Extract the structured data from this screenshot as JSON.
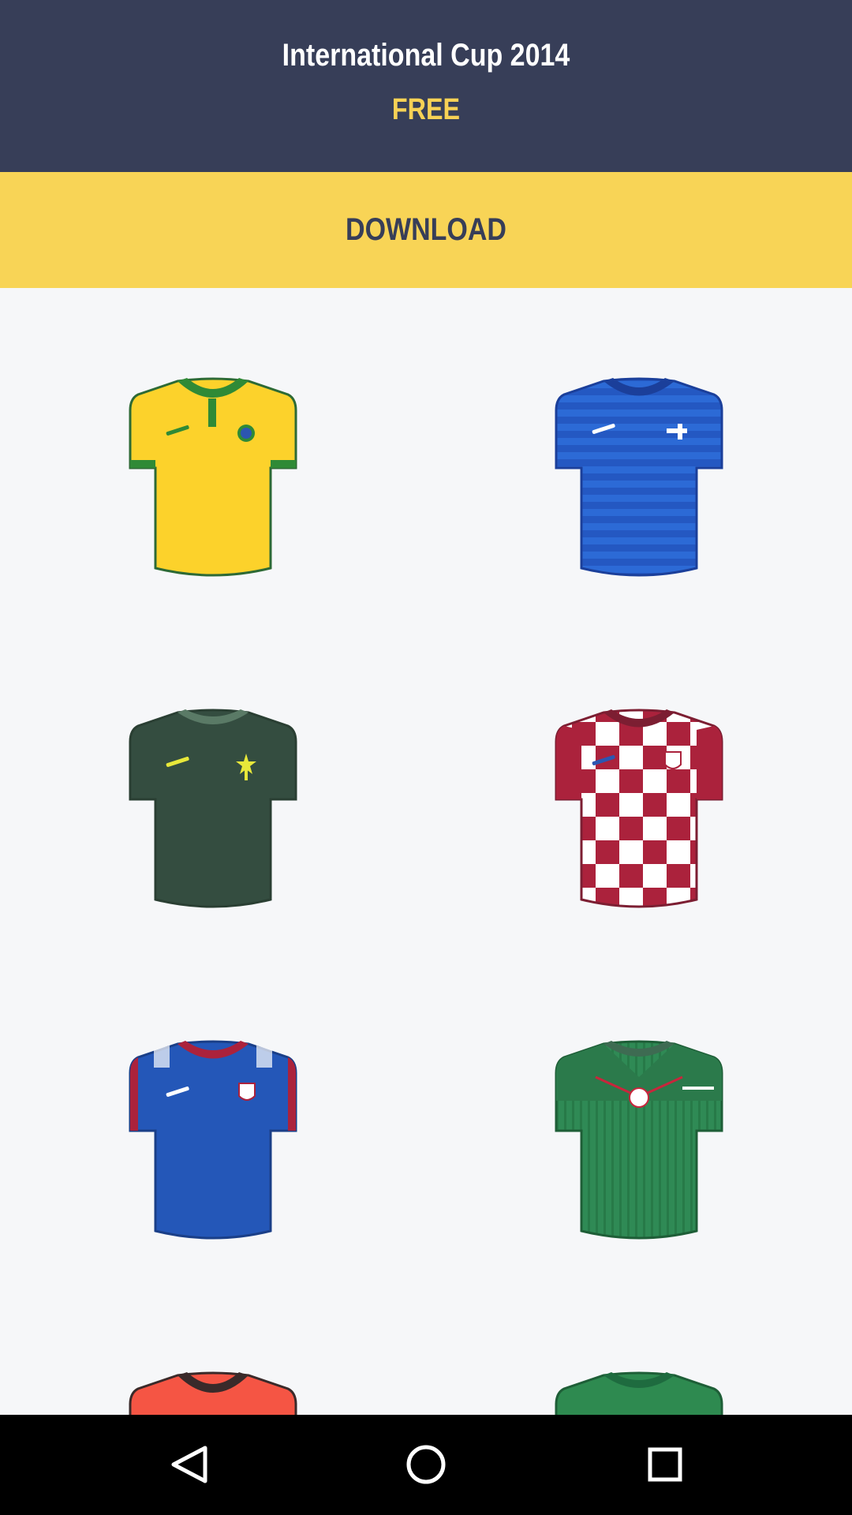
{
  "header": {
    "title": "International Cup 2014",
    "price": "FREE"
  },
  "download": {
    "label": "DOWNLOAD"
  },
  "colors": {
    "header_bg": "#373e58",
    "accent_yellow": "#f8d456",
    "page_bg": "#f6f7f9"
  },
  "jerseys": [
    {
      "name": "yellow-green-jersey"
    },
    {
      "name": "blue-striped-jersey"
    },
    {
      "name": "dark-green-jersey"
    },
    {
      "name": "red-white-checkered-jersey"
    },
    {
      "name": "blue-red-trim-jersey"
    },
    {
      "name": "green-striped-jersey"
    },
    {
      "name": "red-jersey"
    },
    {
      "name": "green-jersey"
    }
  ],
  "navbar": {
    "icons": [
      "back-icon",
      "home-icon",
      "recents-icon"
    ]
  }
}
